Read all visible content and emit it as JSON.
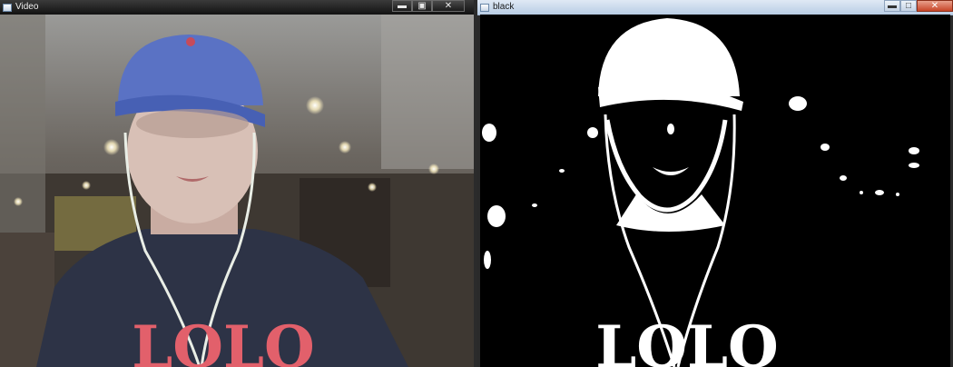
{
  "windows": {
    "video": {
      "title": "Video",
      "controls": {
        "minimize": "▬",
        "maximize": "▣",
        "close": "✕"
      }
    },
    "black": {
      "title": "black",
      "controls": {
        "minimize": "▬",
        "maximize": "□",
        "close": "✕"
      }
    }
  },
  "shirt_text": "LOLO",
  "colors": {
    "cap": "#5a72c4",
    "shirt": "#2d3346",
    "shirt_print": "#e2606b",
    "skin": "#d8c0b6",
    "cafe_bg": "#5a5248",
    "mask_fg": "#ffffff",
    "mask_bg": "#000000"
  },
  "icons": {
    "app": "window-app-icon",
    "minimize": "minimize-icon",
    "maximize": "maximize-icon",
    "close": "close-icon"
  }
}
